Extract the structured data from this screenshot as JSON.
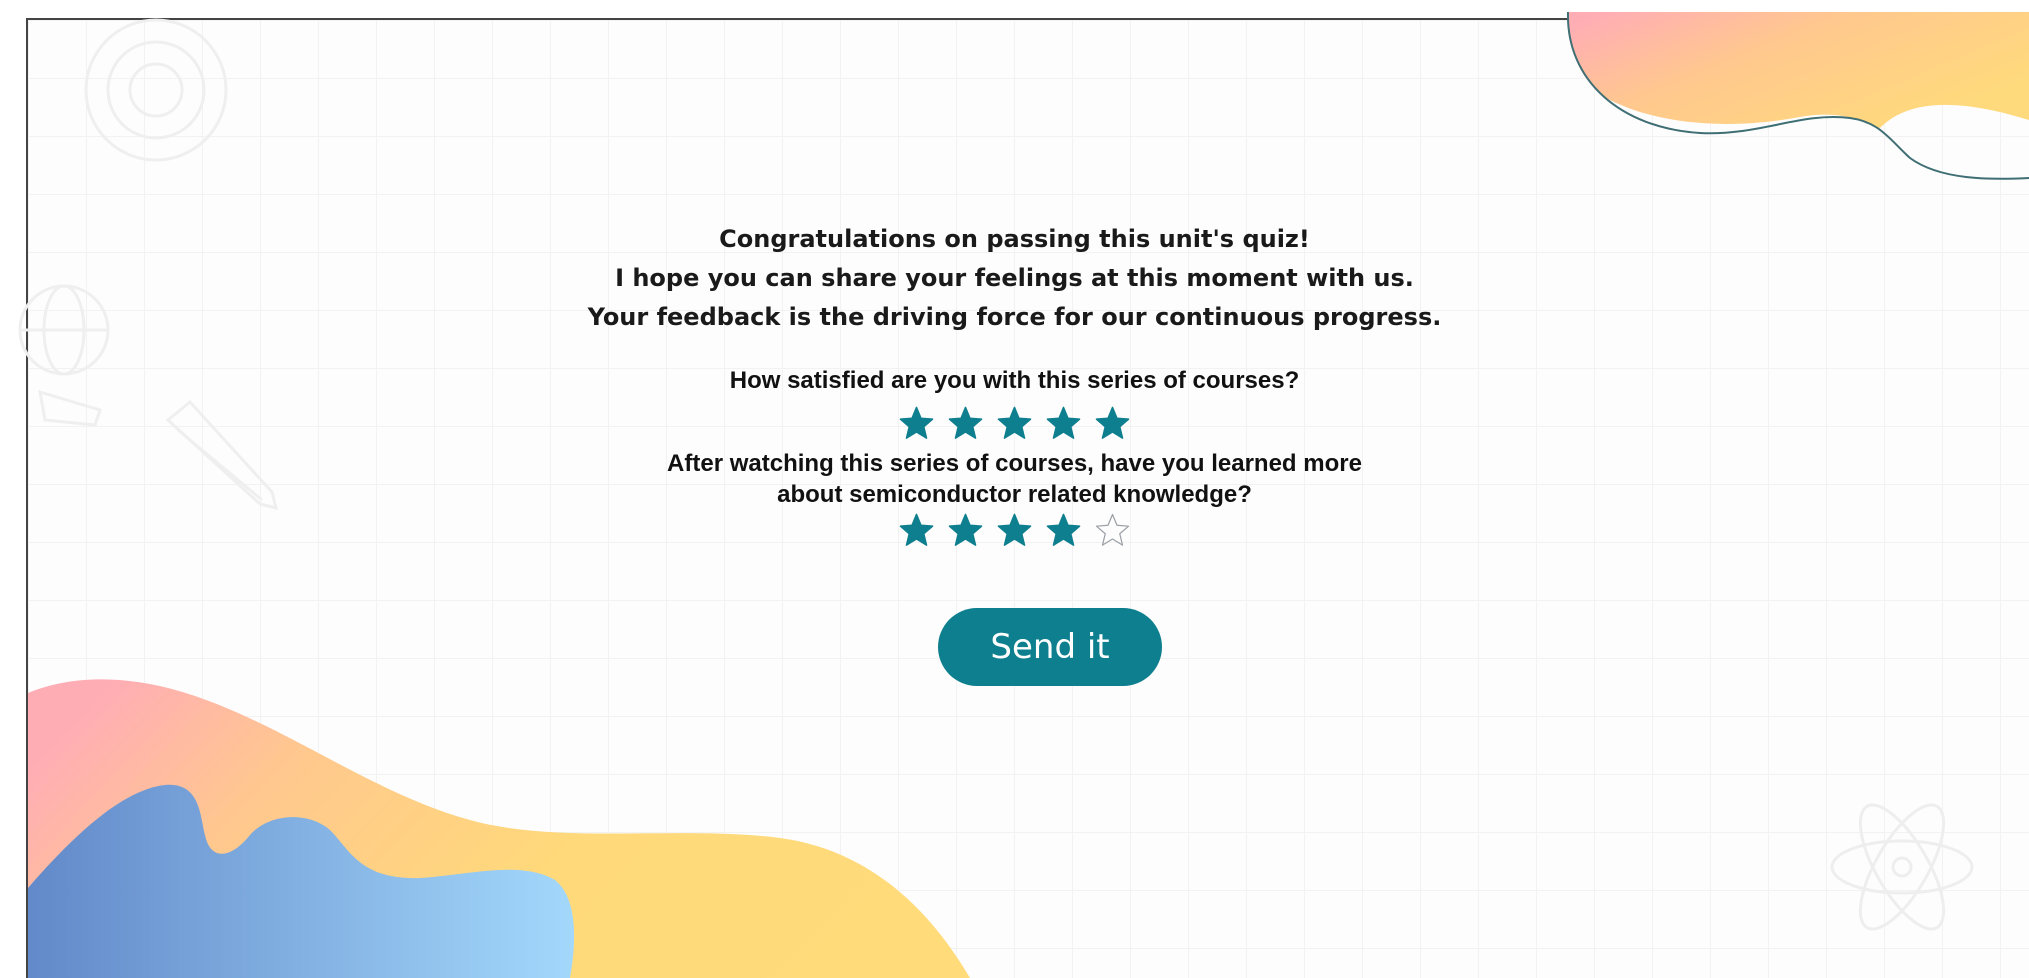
{
  "intro": {
    "line1": "Congratulations on passing this unit's quiz!",
    "line2": "I hope you can share your feelings at this moment with us.",
    "line3": "Your feedback is the driving force for our continuous progress."
  },
  "questions": [
    {
      "text": "How satisfied are you with this series of courses?",
      "rating": 5,
      "max": 5
    },
    {
      "line1": "After watching this series of courses, have you learned more",
      "line2": "about semiconductor related knowledge?",
      "rating": 4,
      "max": 5
    }
  ],
  "submit": {
    "label": "Send it"
  },
  "colors": {
    "accent": "#0e7f8e",
    "star_filled": "#0e7f8e",
    "star_empty_stroke": "#9aa0a6",
    "blob_pink": "#ffadb5",
    "blob_yellow": "#ffd97a",
    "blob_blue_dark": "#6289c9",
    "blob_blue_light": "#a3d8fb"
  },
  "decor_icons": [
    "gear-icon",
    "globe-icon",
    "pencil-icon",
    "atom-icon"
  ]
}
